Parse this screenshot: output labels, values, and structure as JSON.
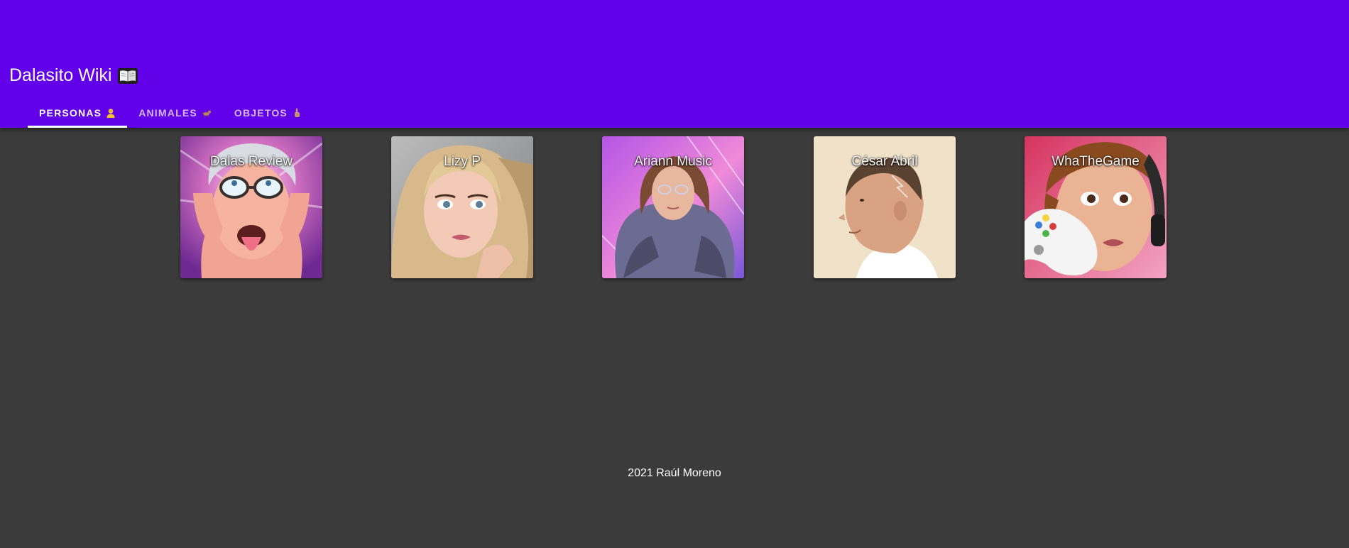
{
  "header": {
    "title": "Dalasito Wiki",
    "title_icon": "open-book-icon",
    "background_color": "#6200ea"
  },
  "tabs": [
    {
      "label": "PERSONAS",
      "icon": "person-icon",
      "active": true
    },
    {
      "label": "ANIMALES",
      "icon": "dog-icon",
      "active": false
    },
    {
      "label": "OBJETOS",
      "icon": "pointing-hand-icon",
      "active": false
    }
  ],
  "cards": [
    {
      "name": "Dalas Review",
      "image": "portrait-dalas-review"
    },
    {
      "name": "Lizy P",
      "image": "portrait-lizy-p"
    },
    {
      "name": "Ariann Music",
      "image": "portrait-ariann-music"
    },
    {
      "name": "César Abril",
      "image": "portrait-cesar-abril"
    },
    {
      "name": "WhaTheGame",
      "image": "portrait-whathegame"
    }
  ],
  "footer": {
    "text": "2021 Raúl Moreno"
  },
  "colors": {
    "page_background": "#3b3b3b",
    "tab_indicator": "#ffffff"
  }
}
